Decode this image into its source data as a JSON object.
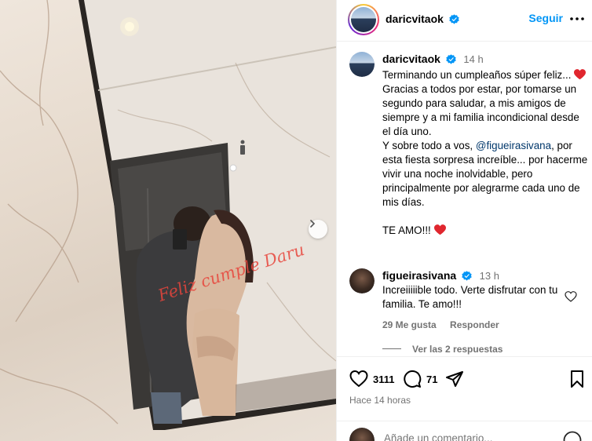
{
  "post_author": {
    "username": "daricvitaok",
    "follow_label": "Seguir"
  },
  "caption": {
    "username": "daricvitaok",
    "time": "14 h",
    "line1": "Terminando un cumpleaños súper feliz...",
    "body": "Gracias a todos por estar, por tomarse un segundo para saludar, a mis amigos de siempre y a mi familia incondicional desde el día uno.",
    "line_pre_mention": "Y sobre todo a vos, ",
    "mention": "@figueirasivana",
    "line_post_mention": ", por esta fiesta sorpresa increíble... por hacerme vivir una noche inolvidable, pero principalmente por alegrarme cada uno de mis días.",
    "closing": "TE AMO!!!"
  },
  "comment": {
    "username": "figueirasivana",
    "time": "13 h",
    "text": "Increiiiiible todo. Verte disfrutar con tu familia. Te amo!!!",
    "likes": "29 Me gusta",
    "reply_label": "Responder",
    "view_replies": "Ver las 2 respuestas"
  },
  "stats": {
    "likes": "3111",
    "comments": "71",
    "time_ago": "Hace 14 horas"
  },
  "add_comment": {
    "placeholder": "Añade un comentario..."
  },
  "photo": {
    "handwriting": "Feliz cumple Daru"
  },
  "colors": {
    "accent": "#0095f6",
    "heart": "#ed4956",
    "muted": "#737373"
  }
}
